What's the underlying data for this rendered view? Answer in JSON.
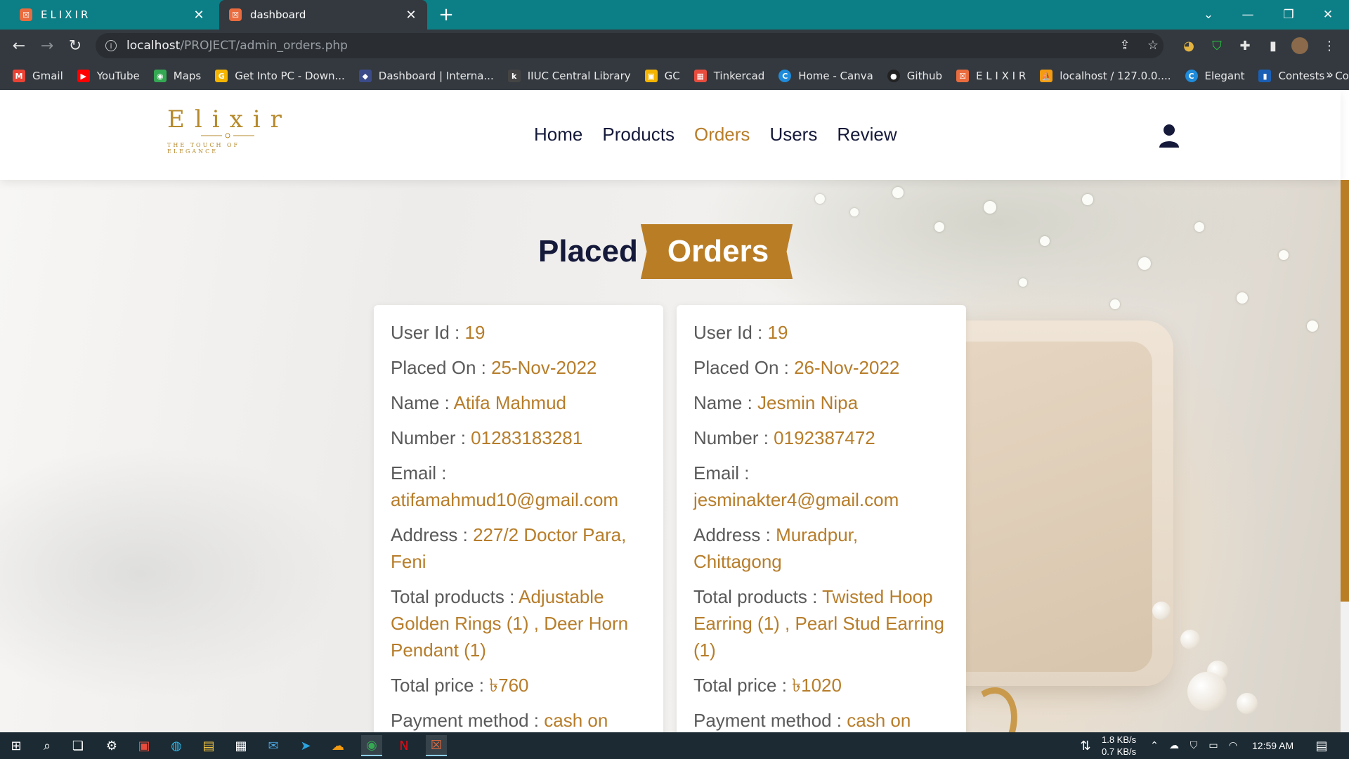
{
  "browser": {
    "tabs": [
      {
        "title": "ELIXIR",
        "favicon": "xampp-icon"
      },
      {
        "title": "dashboard",
        "favicon": "xampp-icon"
      }
    ],
    "url_host": "localhost",
    "url_path": "/PROJECT/admin_orders.php",
    "bookmarks": [
      {
        "label": "Gmail",
        "icon": "gmail-icon",
        "color": "#ea4335"
      },
      {
        "label": "YouTube",
        "icon": "youtube-icon",
        "color": "#ff0000"
      },
      {
        "label": "Maps",
        "icon": "maps-icon",
        "color": "#34a853"
      },
      {
        "label": "Get Into PC - Down...",
        "icon": "getintopc-icon",
        "color": "#f4b400"
      },
      {
        "label": "Dashboard | Interna...",
        "icon": "iiuc-icon",
        "color": "#3b4b8a"
      },
      {
        "label": "IIUC Central Library",
        "icon": "koha-icon",
        "color": "#444444"
      },
      {
        "label": "GC",
        "icon": "classroom-icon",
        "color": "#f4b400"
      },
      {
        "label": "Tinkercad",
        "icon": "tinkercad-icon",
        "color": "#e84c3d"
      },
      {
        "label": "Home - Canva",
        "icon": "canva-icon",
        "color": "#1f8bda"
      },
      {
        "label": "Github",
        "icon": "github-icon",
        "color": "#222222"
      },
      {
        "label": "E L I X I R",
        "icon": "xampp-icon",
        "color": "#e96b3e"
      },
      {
        "label": "localhost / 127.0.0....",
        "icon": "phpmyadmin-icon",
        "color": "#f39c12"
      },
      {
        "label": "Elegant",
        "icon": "canva-icon",
        "color": "#1f8bda"
      },
      {
        "label": "Contests - Codefor...",
        "icon": "codeforces-icon",
        "color": "#f5c518"
      }
    ]
  },
  "site": {
    "logo_text": "Elixir",
    "logo_tagline": "THE TOUCH OF ELEGANCE",
    "nav": [
      {
        "label": "Home",
        "active": false
      },
      {
        "label": "Products",
        "active": false
      },
      {
        "label": "Orders",
        "active": true
      },
      {
        "label": "Users",
        "active": false
      },
      {
        "label": "Review",
        "active": false
      }
    ],
    "heading_part1": "Placed",
    "heading_part2": "Orders",
    "accent_color": "#b77d2a",
    "navy_color": "#15193a"
  },
  "orders": [
    {
      "user_id_label": "User Id : ",
      "user_id": "19",
      "placed_on_label": "Placed On : ",
      "placed_on": "25-Nov-2022",
      "name_label": "Name : ",
      "name": "Atifa Mahmud",
      "number_label": "Number : ",
      "number": "01283183281",
      "email_label": "Email : ",
      "email": "atifamahmud10@gmail.com",
      "address_label": "Address : ",
      "address": "227/2 Doctor Para, Feni",
      "total_products_label": "Total products : ",
      "total_products": "Adjustable Golden Rings (1) , Deer Horn Pendant (1)",
      "total_price_label": "Total price : ",
      "total_price": "৳760",
      "payment_label": "Payment method : ",
      "payment": "cash on"
    },
    {
      "user_id_label": "User Id : ",
      "user_id": "19",
      "placed_on_label": "Placed On : ",
      "placed_on": "26-Nov-2022",
      "name_label": "Name : ",
      "name": "Jesmin Nipa",
      "number_label": "Number : ",
      "number": "0192387472",
      "email_label": "Email : ",
      "email": "jesminakter4@gmail.com",
      "address_label": "Address : ",
      "address": "Muradpur, Chittagong",
      "total_products_label": "Total products : ",
      "total_products": "Twisted Hoop Earring (1) , Pearl Stud Earring (1)",
      "total_price_label": "Total price : ",
      "total_price": "৳1020",
      "payment_label": "Payment method : ",
      "payment": "cash on"
    }
  ],
  "taskbar": {
    "net_down": "1.8 KB/s",
    "net_up": "0.7 KB/s",
    "clock": "12:59 AM"
  }
}
